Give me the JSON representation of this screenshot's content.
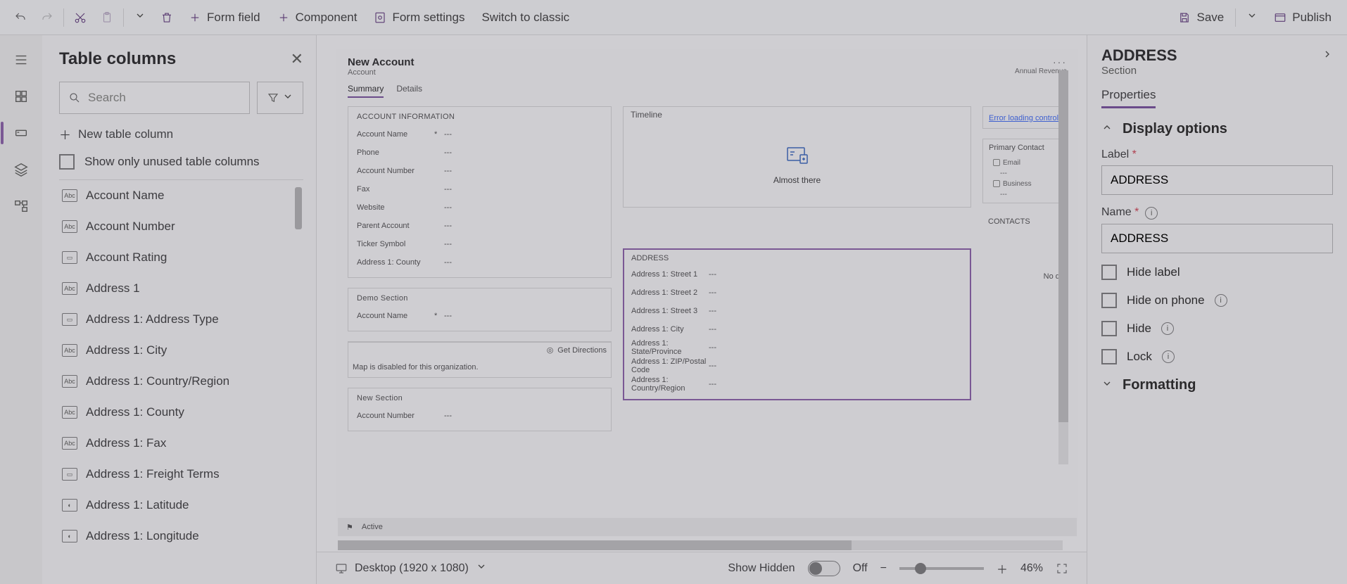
{
  "toolbar": {
    "form_field": "Form field",
    "component": "Component",
    "form_settings": "Form settings",
    "switch_classic": "Switch to classic",
    "save": "Save",
    "publish": "Publish"
  },
  "table_columns": {
    "title": "Table columns",
    "search_placeholder": "Search",
    "new_column": "New table column",
    "show_unused": "Show only unused table columns",
    "items": [
      "Account Name",
      "Account Number",
      "Account Rating",
      "Address 1",
      "Address 1: Address Type",
      "Address 1: City",
      "Address 1: Country/Region",
      "Address 1: County",
      "Address 1: Fax",
      "Address 1: Freight Terms",
      "Address 1: Latitude",
      "Address 1: Longitude"
    ]
  },
  "form": {
    "title": "New Account",
    "entity": "Account",
    "header_kpi": "Annual Revenue",
    "tabs": {
      "summary": "Summary",
      "details": "Details"
    },
    "acct_section": {
      "title": "ACCOUNT INFORMATION",
      "fields": [
        {
          "label": "Account Name",
          "req": "*",
          "val": "---"
        },
        {
          "label": "Phone",
          "req": "",
          "val": "---"
        },
        {
          "label": "Account Number",
          "req": "",
          "val": "---"
        },
        {
          "label": "Fax",
          "req": "",
          "val": "---"
        },
        {
          "label": "Website",
          "req": "",
          "val": "---"
        },
        {
          "label": "Parent Account",
          "req": "",
          "val": "---"
        },
        {
          "label": "Ticker Symbol",
          "req": "",
          "val": "---"
        },
        {
          "label": "Address 1: County",
          "req": "",
          "val": "---"
        }
      ]
    },
    "demo_section": {
      "title": "Demo Section",
      "field": {
        "label": "Account Name",
        "req": "*",
        "val": "---"
      }
    },
    "map_section": {
      "directions": "Get Directions",
      "msg": "Map is disabled for this organization."
    },
    "new_section": {
      "title": "New Section",
      "field": {
        "label": "Account Number",
        "req": "",
        "val": "---"
      }
    },
    "timeline": {
      "title": "Timeline",
      "almost": "Almost there"
    },
    "address": {
      "title": "ADDRESS",
      "rows": [
        "Address 1: Street 1",
        "Address 1: Street 2",
        "Address 1: Street 3",
        "Address 1: City",
        "Address 1: State/Province",
        "Address 1: ZIP/Postal Code",
        "Address 1: Country/Region"
      ],
      "val": "---"
    },
    "right": {
      "error": "Error loading control",
      "primary_contact": "Primary Contact",
      "email": "Email",
      "business": "Business",
      "contacts": "CONTACTS",
      "nodata": "No da"
    },
    "status": {
      "active": "Active"
    }
  },
  "footer": {
    "device": "Desktop (1920 x 1080)",
    "show_hidden": "Show Hidden",
    "off": "Off",
    "zoom_pct": "46%"
  },
  "props": {
    "title": "ADDRESS",
    "subtitle": "Section",
    "tab": "Properties",
    "display_options": "Display options",
    "label_label": "Label",
    "label_value": "ADDRESS",
    "name_label": "Name",
    "name_value": "ADDRESS",
    "hide_label": "Hide label",
    "hide_phone": "Hide on phone",
    "hide": "Hide",
    "lock": "Lock",
    "formatting": "Formatting"
  }
}
